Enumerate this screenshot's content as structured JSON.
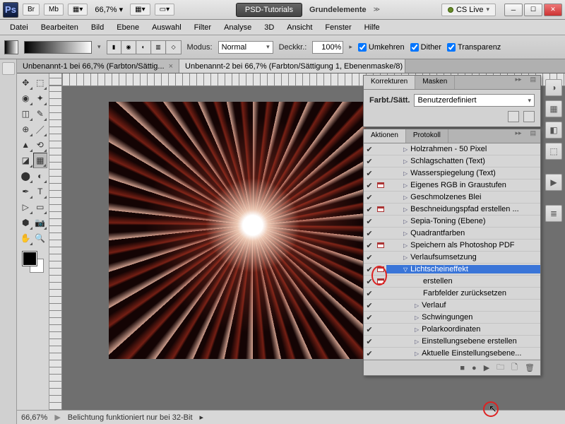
{
  "titlebar": {
    "app": "Ps",
    "btn_br": "Br",
    "btn_mb": "Mb",
    "zoom": "66,7%",
    "pill": "PSD-Tutorials",
    "center": "Grundelemente",
    "cslive": "CS Live"
  },
  "menu": [
    "Datei",
    "Bearbeiten",
    "Bild",
    "Ebene",
    "Auswahl",
    "Filter",
    "Analyse",
    "3D",
    "Ansicht",
    "Fenster",
    "Hilfe"
  ],
  "options": {
    "modus_lbl": "Modus:",
    "modus_val": "Normal",
    "deck_lbl": "Deckkr.:",
    "deck_val": "100%",
    "umkehren": "Umkehren",
    "dither": "Dither",
    "transparenz": "Transparenz"
  },
  "tabs": [
    "Unbenannt-1 bei 66,7% (Farbton/Sättig...",
    "Unbenannt-2 bei 66,7% (Farbton/Sättigung 1, Ebenenmaske/8) *"
  ],
  "panel_corr": {
    "tab1": "Korrekturen",
    "tab2": "Masken",
    "label": "Farbt./Sätt.",
    "preset": "Benutzerdefiniert"
  },
  "panel_act": {
    "tab1": "Aktionen",
    "tab2": "Protokoll",
    "rows": [
      {
        "chk": true,
        "dlg": false,
        "indent": 1,
        "disc": "▷",
        "label": "Holzrahmen - 50 Pixel"
      },
      {
        "chk": true,
        "dlg": false,
        "indent": 1,
        "disc": "▷",
        "label": "Schlagschatten (Text)"
      },
      {
        "chk": true,
        "dlg": false,
        "indent": 1,
        "disc": "▷",
        "label": "Wasserspiegelung (Text)"
      },
      {
        "chk": true,
        "dlg": true,
        "indent": 1,
        "disc": "▷",
        "label": "Eigenes RGB in Graustufen"
      },
      {
        "chk": true,
        "dlg": false,
        "indent": 1,
        "disc": "▷",
        "label": "Geschmolzenes Blei"
      },
      {
        "chk": true,
        "dlg": true,
        "indent": 1,
        "disc": "▷",
        "label": "Beschneidungspfad erstellen ..."
      },
      {
        "chk": true,
        "dlg": false,
        "indent": 1,
        "disc": "▷",
        "label": "Sepia-Toning (Ebene)"
      },
      {
        "chk": true,
        "dlg": false,
        "indent": 1,
        "disc": "▷",
        "label": "Quadrantfarben"
      },
      {
        "chk": true,
        "dlg": true,
        "indent": 1,
        "disc": "▷",
        "label": "Speichern als Photoshop PDF"
      },
      {
        "chk": true,
        "dlg": false,
        "indent": 1,
        "disc": "▷",
        "label": "Verlaufsumsetzung"
      },
      {
        "chk": true,
        "dlg": true,
        "indent": 1,
        "disc": "▽",
        "label": "Lichtscheineffekt",
        "selected": true
      },
      {
        "chk": true,
        "dlg": true,
        "indent": 2,
        "disc": "",
        "label": "erstellen"
      },
      {
        "chk": true,
        "dlg": false,
        "indent": 2,
        "disc": "",
        "label": "Farbfelder zurücksetzen"
      },
      {
        "chk": true,
        "dlg": false,
        "indent": 2,
        "disc": "▷",
        "label": "Verlauf"
      },
      {
        "chk": true,
        "dlg": false,
        "indent": 2,
        "disc": "▷",
        "label": "Schwingungen"
      },
      {
        "chk": true,
        "dlg": false,
        "indent": 2,
        "disc": "▷",
        "label": "Polarkoordinaten"
      },
      {
        "chk": true,
        "dlg": false,
        "indent": 2,
        "disc": "▷",
        "label": "Einstellungsebene erstellen"
      },
      {
        "chk": true,
        "dlg": false,
        "indent": 2,
        "disc": "▷",
        "label": "Aktuelle Einstellungsebene..."
      }
    ]
  },
  "status": {
    "zoom": "66,67%",
    "msg": "Belichtung funktioniert nur bei 32-Bit"
  },
  "tools": [
    "▭",
    "▶",
    "◫",
    "✦",
    "⟋",
    "◢",
    "✎",
    "⌫",
    "⛭",
    "⬚",
    "⚬",
    "◩",
    "◐",
    "●",
    "✥",
    "T",
    "▷",
    "⬡",
    "✋",
    "🔍"
  ]
}
